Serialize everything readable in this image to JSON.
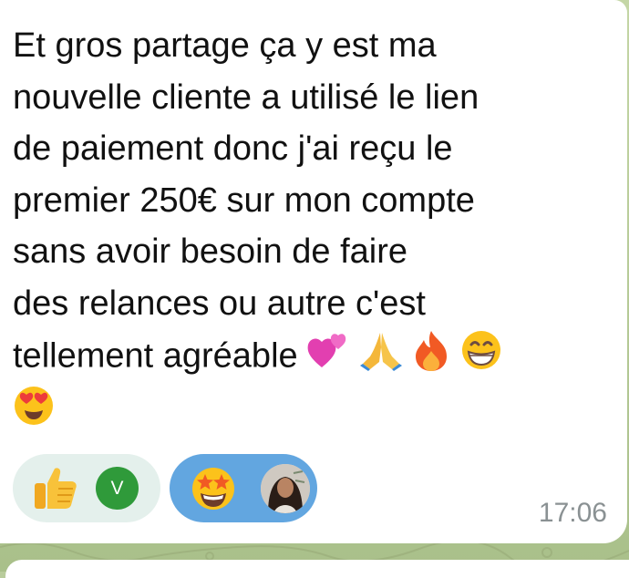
{
  "message": {
    "lines": [
      "Et gros partage ça y est ma",
      "nouvelle cliente a utilisé le lien",
      "de paiement donc j'ai reçu le",
      "premier 250€ sur mon compte",
      "sans avoir besoin de faire",
      "des relances ou autre c'est",
      "tellement agréable"
    ],
    "emojis": [
      "two-hearts-icon",
      "folded-hands-icon",
      "fire-icon",
      "grinning-face-icon",
      "heart-eyes-icon"
    ],
    "time": "17:06"
  },
  "reactions": [
    {
      "emoji": "thumbs-up-icon",
      "reactor_initial": "V"
    },
    {
      "emoji": "star-struck-icon",
      "reactor": "avatar-photo"
    }
  ],
  "colors": {
    "bubble": "#ffffff",
    "text": "#111111",
    "timestamp": "#8a9193",
    "reaction_light": "#e4f0ec",
    "reaction_selected": "#62a6e0",
    "reactor_green": "#2f9a3a",
    "chat_background": "#b9cc9c"
  }
}
